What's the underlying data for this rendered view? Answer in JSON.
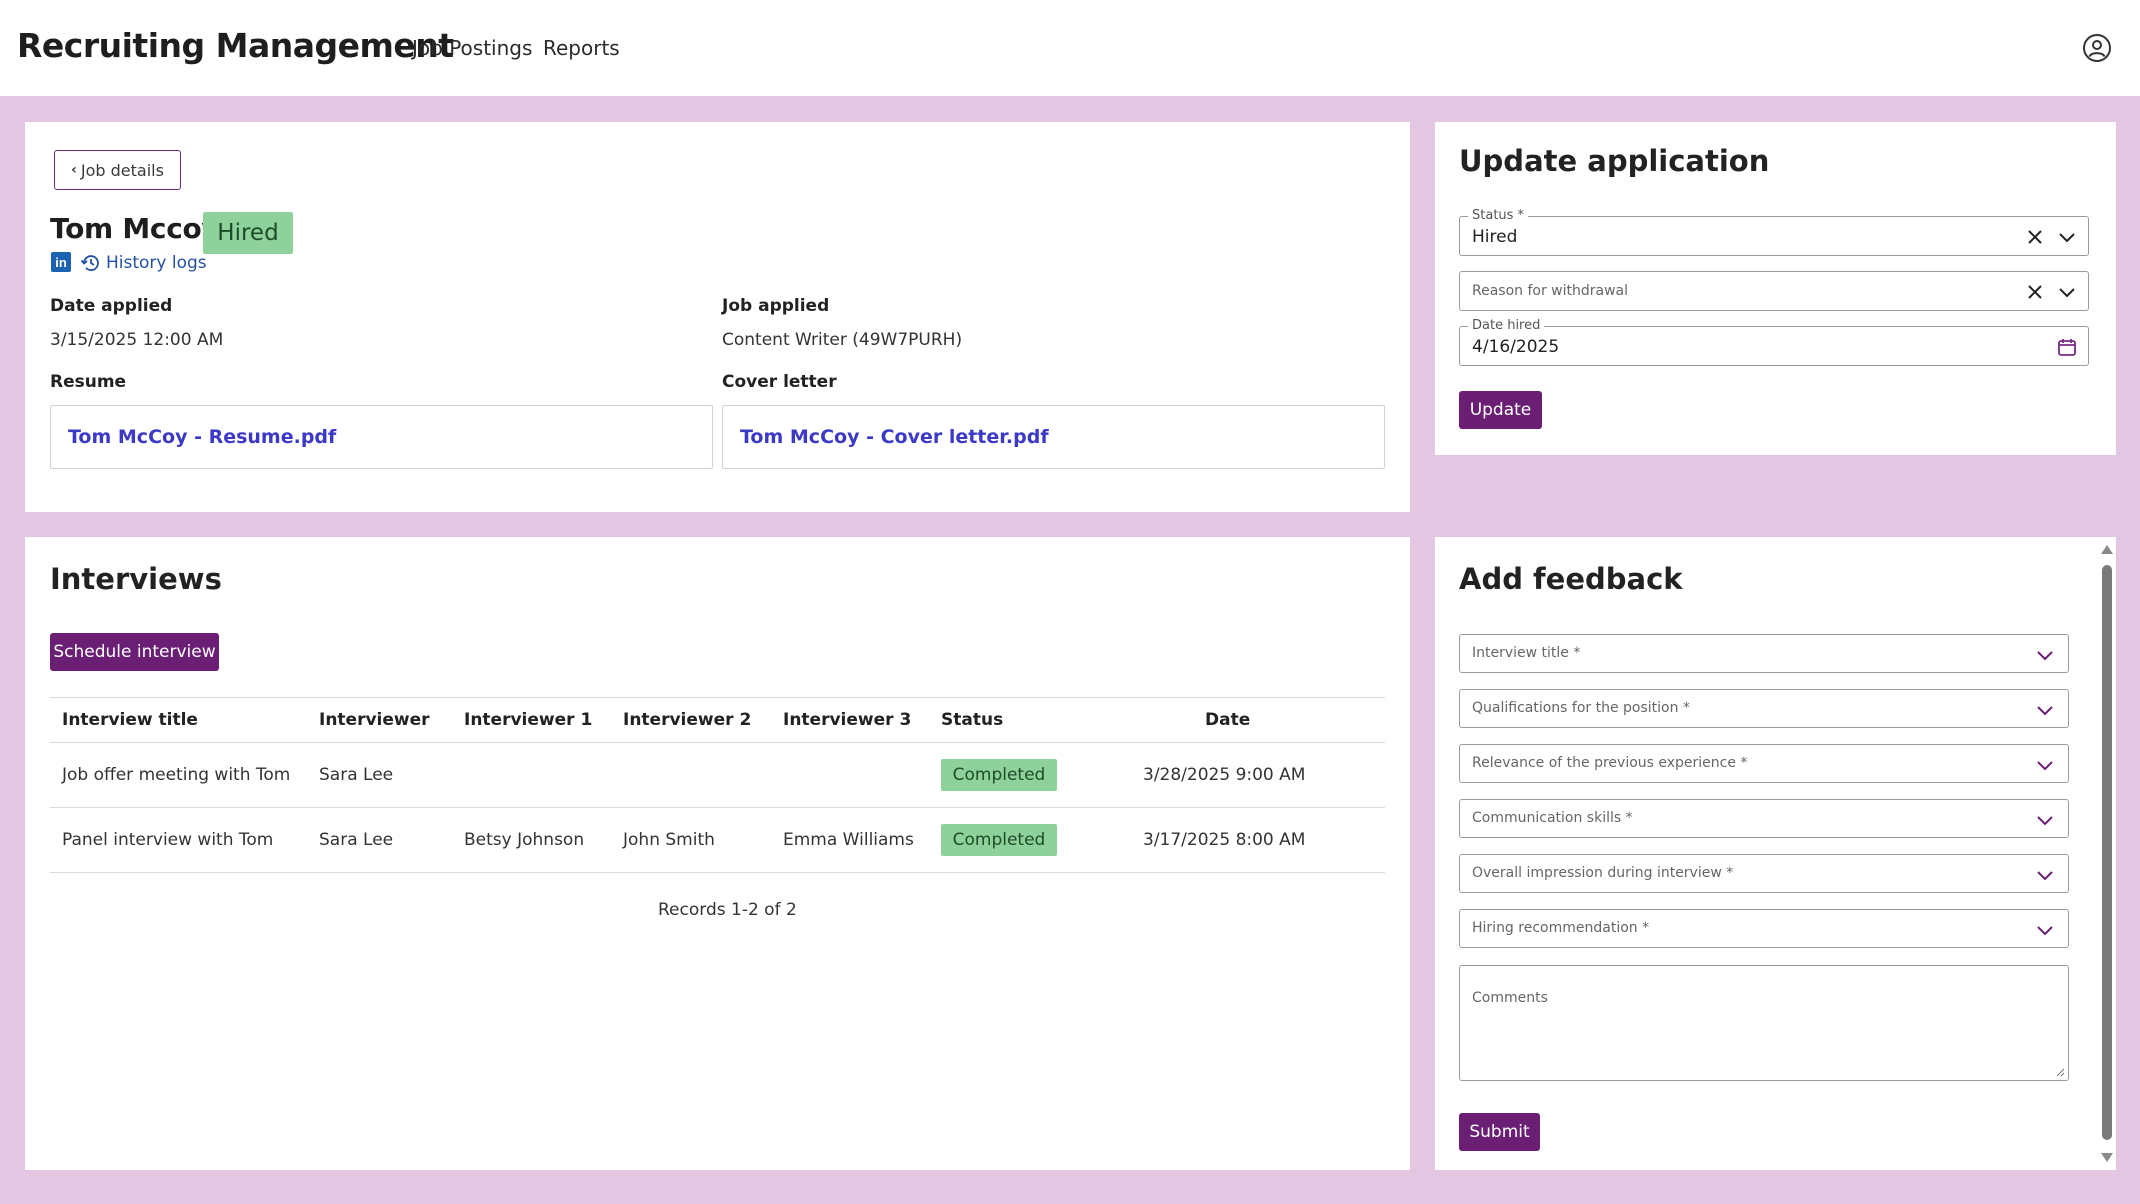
{
  "header": {
    "app_title": "Recruiting Management",
    "nav": [
      "Job Postings",
      "Reports"
    ],
    "user_icon": "user-circle-icon"
  },
  "application": {
    "back_label": "Job details",
    "candidate_name": "Tom Mccoy",
    "status_badge": "Hired",
    "linkedin_icon": "in",
    "history_label": "History logs",
    "date_applied_label": "Date applied",
    "date_applied_value": "3/15/2025 12:00 AM",
    "job_applied_label": "Job applied",
    "job_applied_value": "Content Writer (49W7PURH)",
    "resume_label": "Resume",
    "resume_file": "Tom McCoy - Resume.pdf",
    "cover_label": "Cover letter",
    "cover_file": "Tom McCoy - Cover letter.pdf"
  },
  "update": {
    "heading": "Update application",
    "status_label": "Status *",
    "status_value": "Hired",
    "withdrawal_placeholder": "Reason for withdrawal",
    "date_hired_label": "Date hired",
    "date_hired_value": "4/16/2025",
    "button": "Update"
  },
  "interviews": {
    "heading": "Interviews",
    "schedule_button": "Schedule interview",
    "columns": [
      "Interview title",
      "Interviewer",
      "Interviewer 1",
      "Interviewer 2",
      "Interviewer 3",
      "Status",
      "Date"
    ],
    "rows": [
      [
        "Job offer meeting with Tom",
        "Sara Lee",
        "",
        "",
        "",
        "Completed",
        "3/28/2025 9:00 AM"
      ],
      [
        "Panel interview with Tom",
        "Sara Lee",
        "Betsy Johnson",
        "John Smith",
        "Emma Williams",
        "Completed",
        "3/17/2025 8:00 AM"
      ]
    ],
    "records": "Records 1-2 of 2",
    "status_color": "#8ed19a"
  },
  "feedback": {
    "heading": "Add feedback",
    "selects": [
      "Interview title *",
      "Qualifications for the position *",
      "Relevance of the previous experience *",
      "Communication skills *",
      "Overall impression during interview *",
      "Hiring recommendation *"
    ],
    "comments_placeholder": "Comments",
    "submit": "Submit"
  },
  "colors": {
    "background": "#e2c6e2",
    "primary": "#6a1f74",
    "success": "#8ed19a",
    "link": "#3b39c6"
  }
}
